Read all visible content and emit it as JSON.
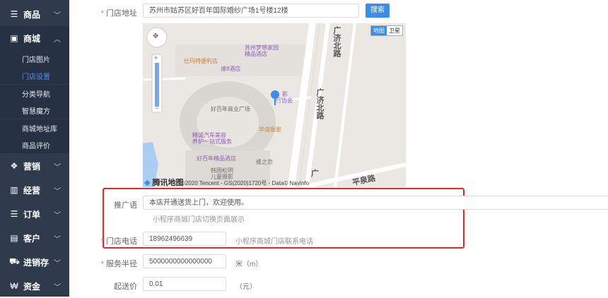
{
  "sidebar": {
    "items": [
      {
        "label": "商品",
        "icon": "list-icon"
      },
      {
        "label": "商城",
        "icon": "shop-icon"
      },
      {
        "label": "营销",
        "icon": "gift-icon"
      },
      {
        "label": "经营",
        "icon": "bar-chart-icon"
      },
      {
        "label": "订单",
        "icon": "list-icon"
      },
      {
        "label": "客户",
        "icon": "id-card-icon"
      },
      {
        "label": "进销存",
        "icon": "truck-icon"
      },
      {
        "label": "资金",
        "icon": "yen-icon"
      }
    ],
    "submenu": [
      "门店图片",
      "门店设置",
      "分类导航",
      "智慧魔方",
      "商城地址库",
      "商品评价"
    ],
    "active_sub": "门店设置"
  },
  "form": {
    "address": {
      "label": "门店地址",
      "value": "苏州市姑苏区好百年国际婚纱广场1号楼12楼",
      "search_label": "搜索"
    },
    "map": {
      "type_map": "地图",
      "type_satellite": "卫星",
      "logo": "腾讯地图",
      "copyright": "©2020 Tencent - GS(2020)1720号 - Data© NavInfo",
      "pois": [
        "苏州梦想家园",
        "精品酒店",
        "仕玛特便利店",
        "速8酒店",
        "好百年商业广场",
        "影",
        "行协会",
        "华谊振宏",
        "精诚汽车美容",
        "养护一站式服务",
        "好百年精品酒店",
        "维之恋",
        "韩国松明",
        "儿童摄影"
      ],
      "roads": [
        "广济北路",
        "广济北路",
        "平泉路",
        "广"
      ]
    },
    "promo": {
      "label": "推广语",
      "value": "本店开通送货上门，欢迎使用。",
      "hint": "小程序商城门店切换页面展示"
    },
    "phone": {
      "label": "门店电话",
      "value": "18962496639",
      "hint": "小程序商城门店联系电话"
    },
    "radius": {
      "label": "服务半径",
      "value": "5000000000000000",
      "unit": "米（m）"
    },
    "min_price": {
      "label": "起送价",
      "value": "0.01",
      "unit": "（元）"
    }
  }
}
